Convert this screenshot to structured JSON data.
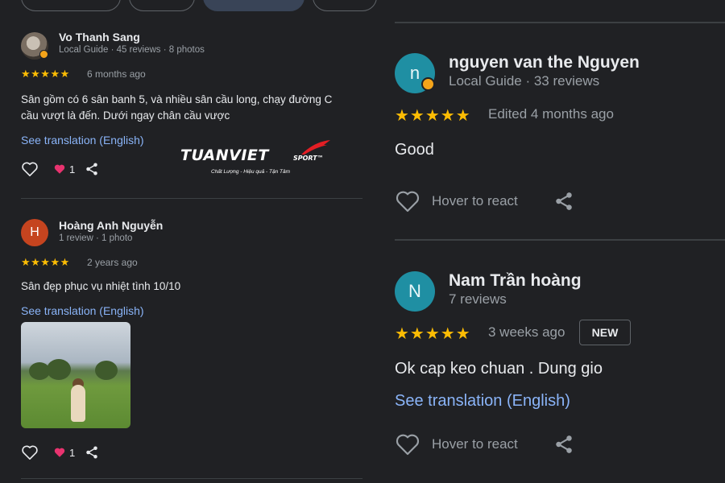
{
  "filter_chips": [
    "",
    "",
    "",
    ""
  ],
  "left_reviews": [
    {
      "name": "Vo Thanh Sang",
      "meta": "Local Guide · 45 reviews · 8 photos",
      "stars": "★★★★★",
      "time": "6 months ago",
      "text_line1": "Sân gồm có 6 sân banh 5, và nhiều sân cầu long, chạy đường C",
      "text_line2": "cầu vượt là đến. Dưới ngay chân cầu vược",
      "translation": "See translation (English)",
      "love_count": "1"
    },
    {
      "name": "Hoàng Anh Nguyễn",
      "avatar_letter": "H",
      "meta": "1 review · 1 photo",
      "stars": "★★★★★",
      "time": "2 years ago",
      "text_line1": "Sân đẹp phục vụ nhiệt tình 10/10",
      "translation": "See translation (English)",
      "love_count": "1"
    }
  ],
  "logo": {
    "main": "TUANVIET",
    "sport": "SPORT",
    "tm": "™",
    "tagline": "Chất Lượng - Hiệu quả - Tận Tâm"
  },
  "right_reviews": [
    {
      "name": "nguyen van the Nguyen",
      "avatar_letter": "n",
      "meta": "Local Guide · 33 reviews",
      "stars": "★★★★★",
      "time": "Edited 4 months ago",
      "text": "Good",
      "react_label": "Hover to react"
    },
    {
      "name": "Nam Trần hoàng",
      "avatar_letter": "N",
      "meta": "7 reviews",
      "stars": "★★★★★",
      "time": "3 weeks ago",
      "badge": "NEW",
      "text": "Ok cap keo chuan . Dung gio",
      "translation": "See translation (English)",
      "react_label": "Hover to react"
    }
  ],
  "icons": [
    "heart-outline-icon",
    "heart-filled-icon",
    "share-icon",
    "local-guide-badge-icon"
  ],
  "colors": {
    "background": "#202124",
    "star": "#fbbc04",
    "link": "#8ab4f8",
    "avatar_teal": "#1f8fa3",
    "avatar_orange": "#c5441f",
    "heart_pink": "#e8336f",
    "logo_red": "#e31e24"
  }
}
